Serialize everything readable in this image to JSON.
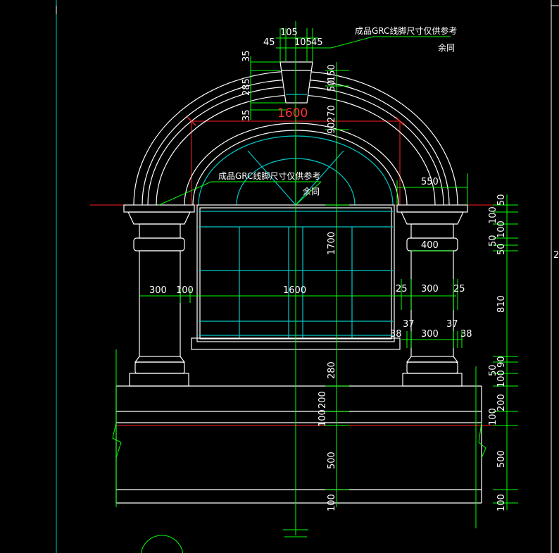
{
  "notes": {
    "grc_top": "成品GRC线脚尺寸仅供参考",
    "same_top": "余同",
    "grc_mid": "成品GRC线脚尺寸仅供参考",
    "same_mid": "余同"
  },
  "keystone": {
    "top_total": "105",
    "top_left": "45",
    "top_mid": "105",
    "top_right": "45",
    "h1": "35",
    "h2": "285",
    "h3": "35"
  },
  "arch": {
    "span": "1600",
    "right_ext": "550",
    "right_v1": "50",
    "right_v2": "270",
    "right_v3": "150",
    "right_v4": "90",
    "window_h": "1700"
  },
  "width_row": {
    "left_col": "300",
    "left_gap": "100",
    "window": "1600",
    "r1": "25",
    "r2": "300",
    "r3": "25"
  },
  "base_row": {
    "a": "37",
    "b": "37",
    "c": "38",
    "d": "300",
    "e": "38"
  },
  "capital": {
    "width": "400"
  },
  "right_chain": [
    "50",
    "100",
    "50",
    "100",
    "50",
    "810",
    "50",
    "90",
    "100",
    "200",
    "100",
    "500",
    "100"
  ],
  "center_chain": [
    "280",
    "200",
    "100",
    "500",
    "100"
  ],
  "cut_label": "2"
}
